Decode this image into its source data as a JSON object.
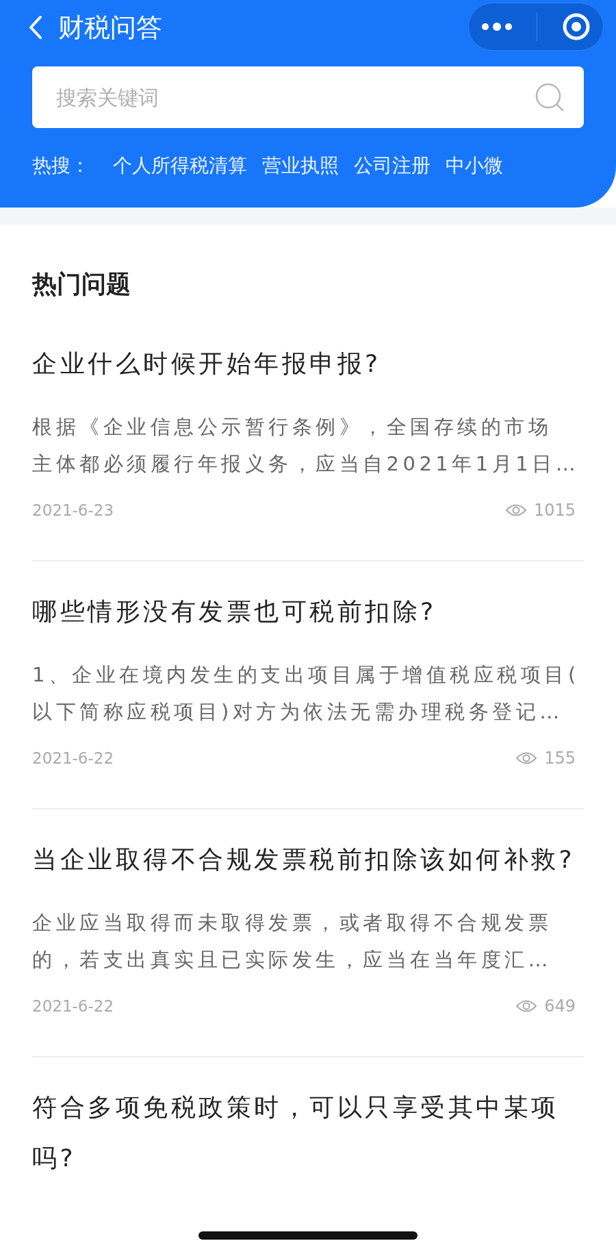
{
  "header": {
    "title": "财税问答",
    "search": {
      "placeholder": "搜索关键词"
    },
    "hot_label": "热搜：",
    "hot_terms": [
      "个人所得税清算",
      "营业执照",
      "公司注册",
      "中小微"
    ]
  },
  "section_title": "热门问题",
  "questions": [
    {
      "title": "企业什么时候开始年报申报?",
      "summary_lines": [
        "根据《企业信息公示暂行条例》，全国存续的市场",
        "主体都必须履行年报义务，应当自2021年1月1日…"
      ],
      "date": "2021-6-23",
      "views": "1015"
    },
    {
      "title": "哪些情形没有发票也可税前扣除?",
      "summary_lines": [
        "1、企业在境内发生的支出项目属于增值税应税项目(",
        "以下简称应税项目)对方为依法无需办理税务登记…"
      ],
      "date": "2021-6-22",
      "views": "155"
    },
    {
      "title": "当企业取得不合规发票税前扣除该如何补救?",
      "summary_lines": [
        "企业应当取得而未取得发票，或者取得不合规发票",
        "的，若支出真实且已实际发生，应当在当年度汇…"
      ],
      "date": "2021-6-22",
      "views": "649"
    },
    {
      "title": "符合多项免税政策时，可以只享受其中某项吗?"
    }
  ]
}
